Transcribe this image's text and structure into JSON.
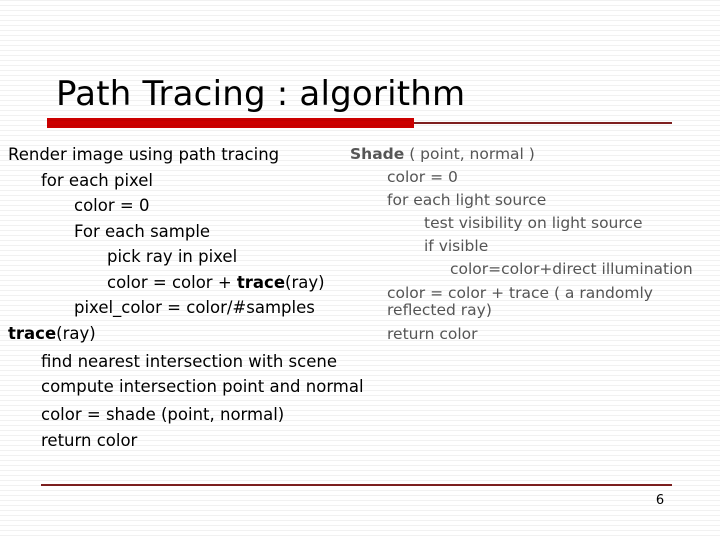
{
  "slide": {
    "title": "Path Tracing : algorithm",
    "page_number": "6",
    "accent_color": "#cc0000",
    "rule_color": "#7f2020",
    "left_text_color": "#000000",
    "right_text_color": "#565656"
  },
  "left_column": {
    "lines": [
      {
        "indent": 0,
        "text": "Render image using path tracing"
      },
      {
        "indent": 1,
        "text": "for each pixel"
      },
      {
        "indent": 2,
        "text": "color = 0"
      },
      {
        "indent": 2,
        "text": "For each sample"
      },
      {
        "indent": 3,
        "text": "pick ray in pixel"
      },
      {
        "indent": 3,
        "pre": "color = color + ",
        "bold": "trace",
        "post": "(ray)"
      },
      {
        "indent": 2,
        "text": "pixel_color = color/#samples"
      },
      {
        "indent": 0,
        "bold": "trace",
        "post": "(ray)"
      },
      {
        "indent": 1,
        "text": "find nearest intersection with scene",
        "wrap": true
      },
      {
        "indent": 1,
        "text": "compute intersection point and normal",
        "wrap": true
      },
      {
        "indent": 1,
        "text": "color = shade (point, normal)"
      },
      {
        "indent": 1,
        "text": "return color"
      }
    ]
  },
  "right_column": {
    "lines": [
      {
        "indent": 0,
        "bold": "Shade",
        "post": " ( point, normal )"
      },
      {
        "indent": 1,
        "text": "color = 0"
      },
      {
        "indent": 1,
        "text": "for each light source"
      },
      {
        "indent": 2,
        "text": "test visibility on light source"
      },
      {
        "indent": 2,
        "text": "if visible"
      },
      {
        "indent": 3,
        "text": "color=color+direct illumination"
      },
      {
        "indent": 1,
        "text": "color = color + trace ( a randomly reflected ray)",
        "wrap": true
      },
      {
        "indent": 1,
        "text": "return color"
      }
    ]
  }
}
